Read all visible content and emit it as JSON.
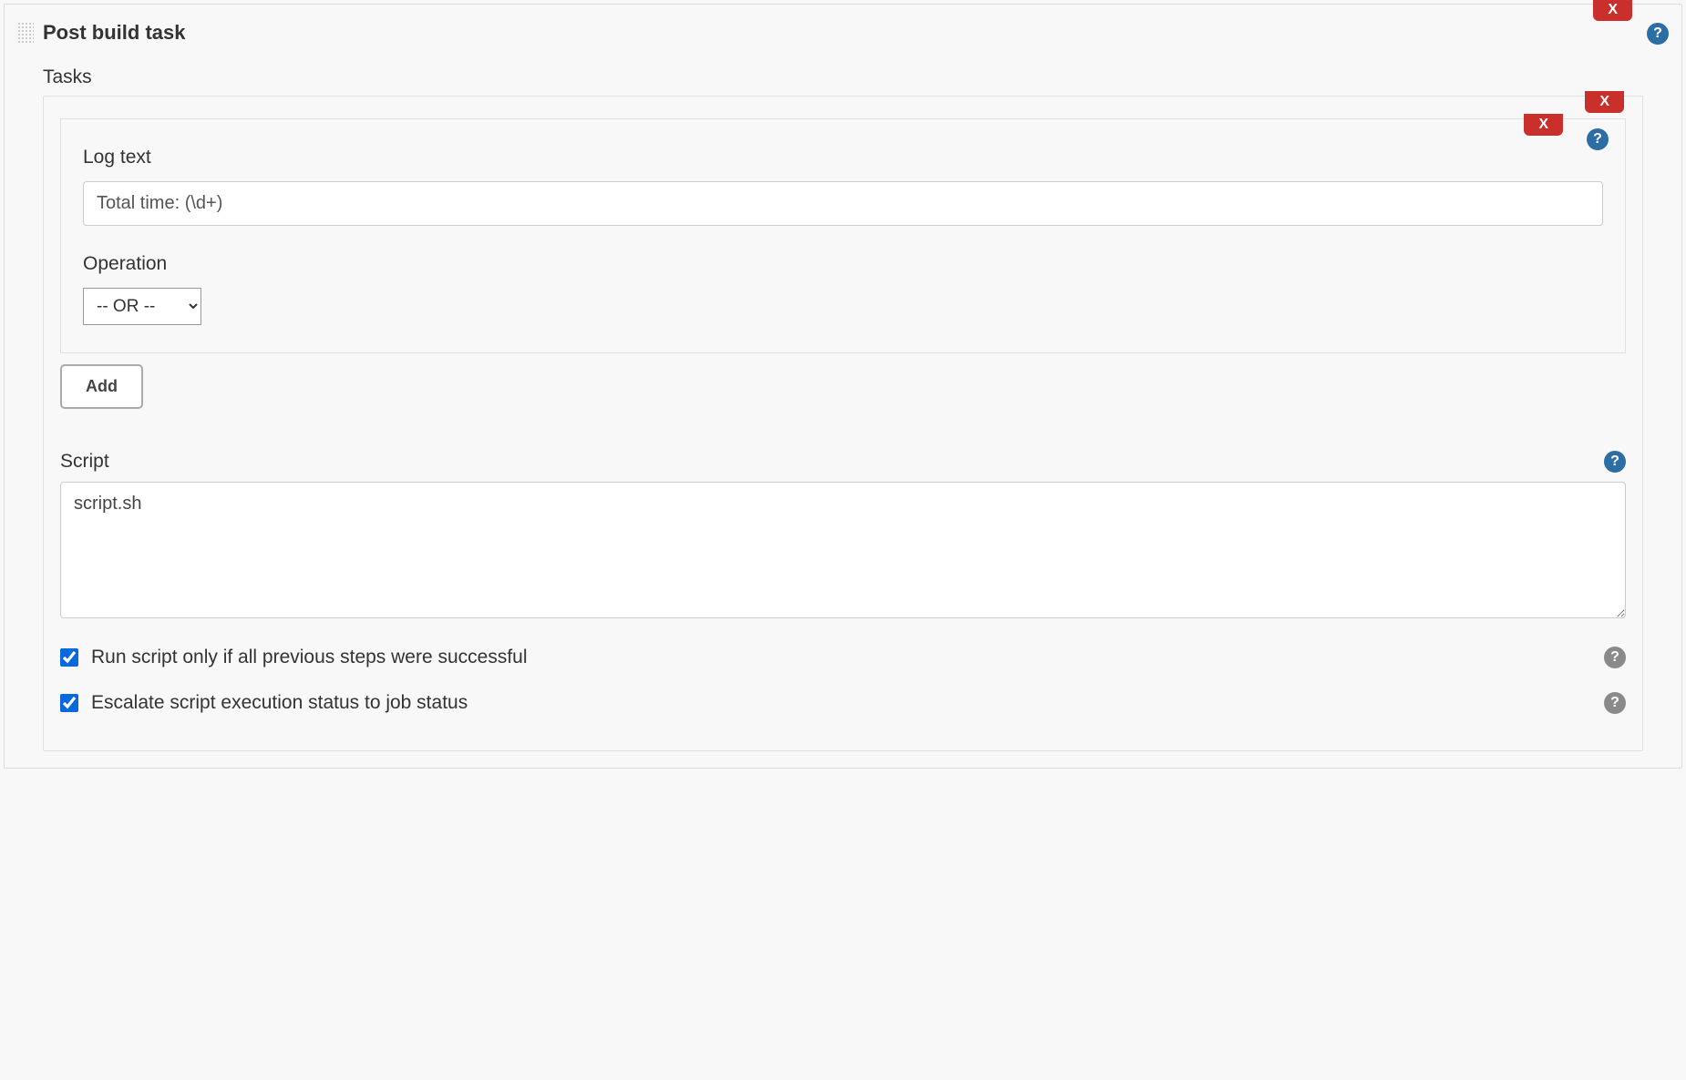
{
  "section": {
    "title": "Post build task",
    "remove_label": "X"
  },
  "tasks": {
    "heading": "Tasks",
    "remove_label": "X",
    "log": {
      "remove_label": "X",
      "log_text_label": "Log text",
      "log_text_value": "Total time: (\\d+)",
      "operation_label": "Operation",
      "operation_value": "-- OR --"
    },
    "add_label": "Add",
    "script": {
      "label": "Script",
      "value": "script.sh"
    },
    "run_only_success": {
      "label": "Run script only if all previous steps were successful",
      "checked": true
    },
    "escalate": {
      "label": "Escalate script execution status to job status",
      "checked": true
    }
  }
}
